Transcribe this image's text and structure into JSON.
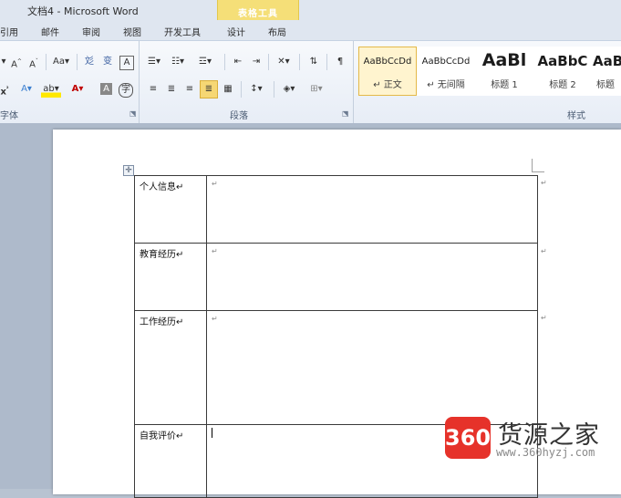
{
  "window": {
    "title": "文档4 - Microsoft Word",
    "contextual_group": "表格工具"
  },
  "tabs": [
    "引用",
    "邮件",
    "审阅",
    "视图",
    "开发工具",
    "设计",
    "布局"
  ],
  "ribbon": {
    "font_group": {
      "label": "字体",
      "row1": [
        "A˄",
        "A˅",
        "Aa▾",
        "彣",
        "变",
        "A"
      ],
      "row2": [
        "x²",
        "A▾",
        "ab▾",
        "A▾",
        "A",
        "字"
      ]
    },
    "paragraph_group": {
      "label": "段落"
    },
    "styles_group": {
      "label": "样式",
      "items": [
        {
          "sample": "AaBbCcDd",
          "name": "↵ 正文",
          "selected": true
        },
        {
          "sample": "AaBbCcDd",
          "name": "↵ 无间隔",
          "selected": false
        },
        {
          "sample": "AaBl",
          "name": "标题 1",
          "selected": false
        },
        {
          "sample": "AaBbC",
          "name": "标题 2",
          "selected": false
        },
        {
          "sample": "AaB",
          "name": "标题",
          "selected": false
        }
      ]
    }
  },
  "table": {
    "rows": [
      {
        "label": "个人信息↵",
        "value": "↵"
      },
      {
        "label": "教育经历↵",
        "value": "↵"
      },
      {
        "label": "工作经历↵",
        "value": "↵"
      },
      {
        "label": "自我评价↵",
        "value": ""
      }
    ],
    "row_end_mark": "↵",
    "move_handle": "✛"
  },
  "watermark": {
    "badge": "360",
    "name": "货源之家",
    "url": "www.360hyzj.com"
  },
  "colors": {
    "accent_yellow": "#f5df78",
    "ribbon_bg": "#e7edf6",
    "watermark_red": "#e6322a"
  }
}
